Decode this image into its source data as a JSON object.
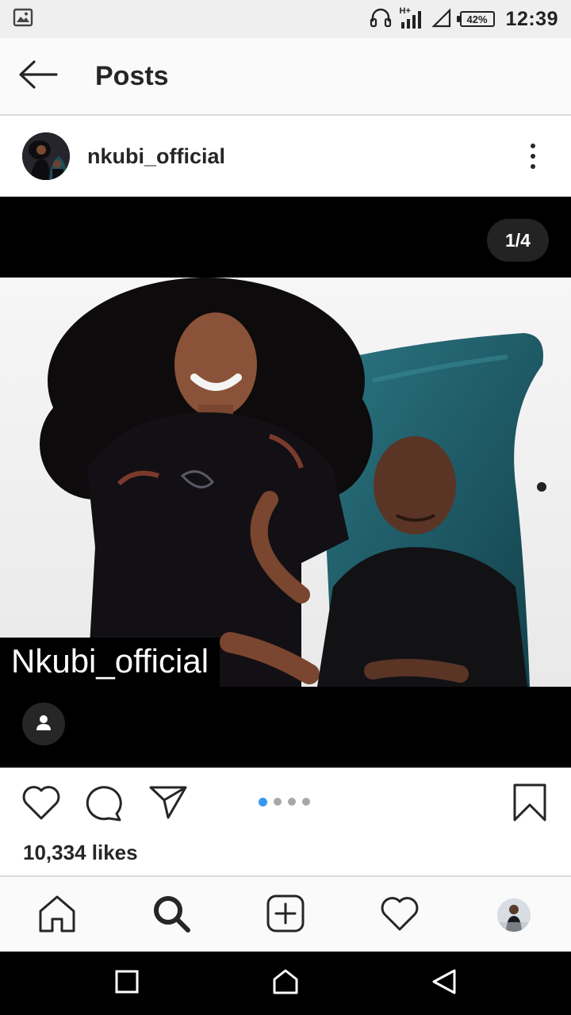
{
  "status_bar": {
    "icons": [
      "image-notification-icon",
      "headphones-icon",
      "signal-h-plus-icon",
      "signal-strength-icon",
      "battery-icon"
    ],
    "network_label": "H+",
    "battery_percent": "42%",
    "battery_level": 0.42,
    "time": "12:39"
  },
  "header": {
    "title": "Posts",
    "back_icon": "arrow-left-icon"
  },
  "post": {
    "username": "nkubi_official",
    "more_icon": "more-vertical-icon",
    "media": {
      "counter": "1/4",
      "current_slide": 1,
      "total_slides": 4,
      "overlay_caption": "Nkubi_official",
      "tag_icon": "user-tag-icon"
    },
    "actions": {
      "icons": [
        "heart-icon",
        "comment-icon",
        "share-icon",
        "bookmark-icon"
      ]
    },
    "likes": "10,334 likes"
  },
  "bottom_nav": {
    "items": [
      "home-icon",
      "search-icon",
      "add-post-icon",
      "activity-heart-icon",
      "profile-avatar"
    ],
    "active": "search"
  },
  "system_nav": {
    "items": [
      "recents-square-icon",
      "home-outline-icon",
      "back-triangle-icon"
    ]
  },
  "colors": {
    "accent_blue": "#3897f0",
    "text": "#262626",
    "chair_teal": "#1e5a66",
    "dot_inactive": "#a8a8a8"
  }
}
